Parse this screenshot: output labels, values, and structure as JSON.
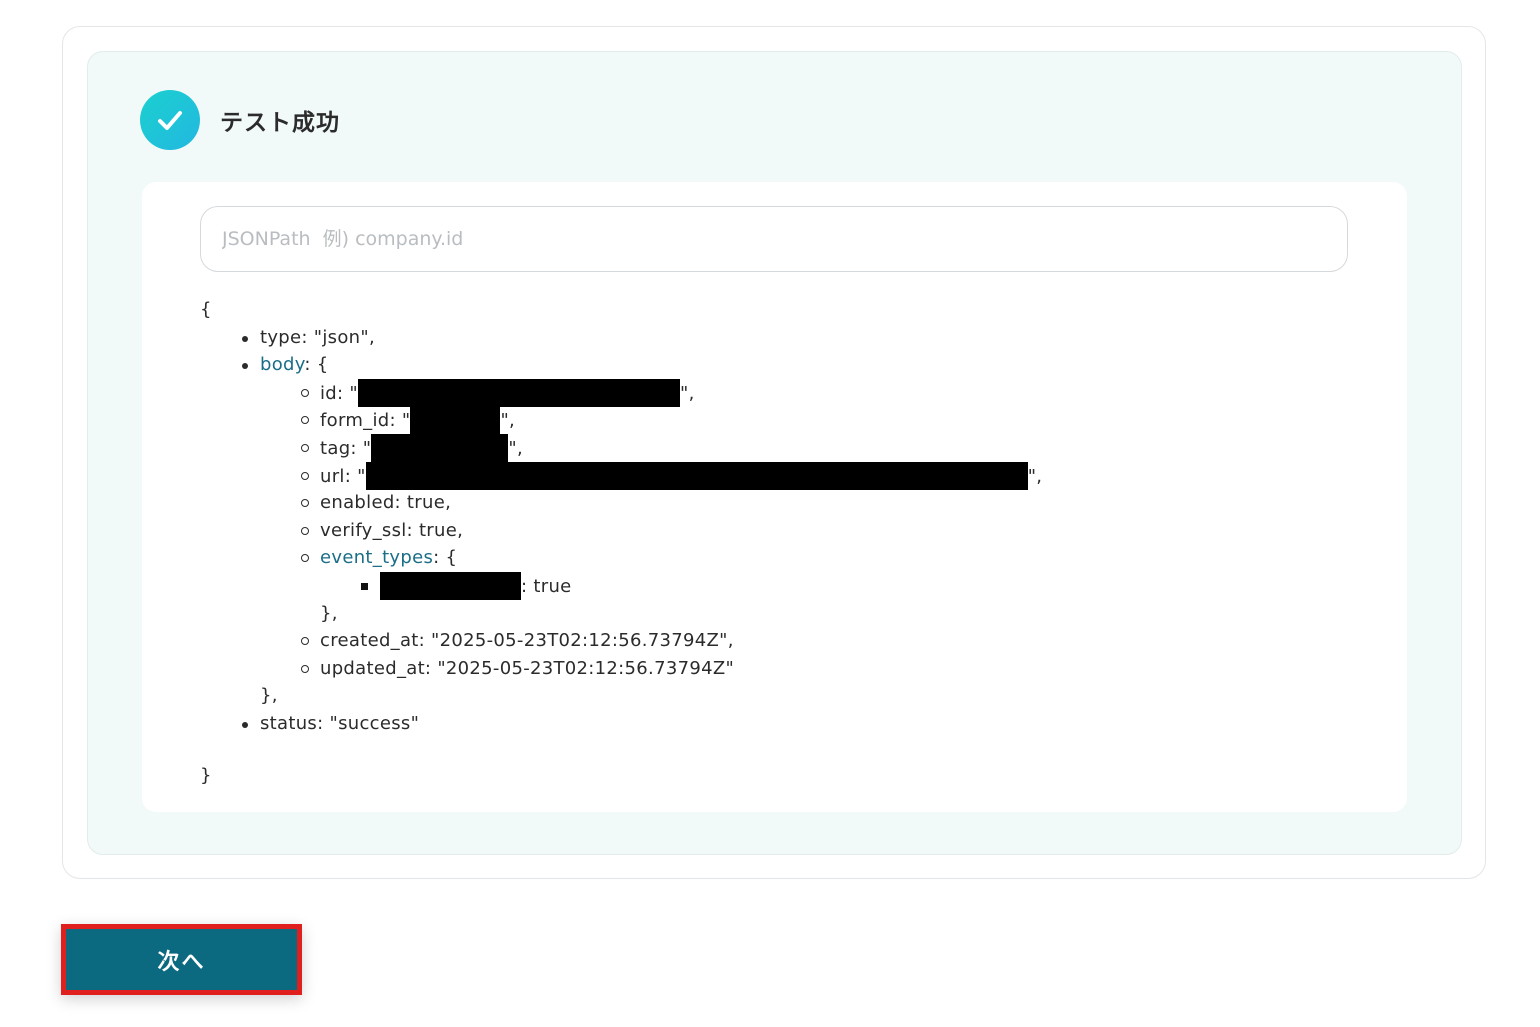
{
  "status": {
    "title": "テスト成功",
    "icon": "check-circle-icon",
    "color": "#1fc4d8"
  },
  "jsonpath_input": {
    "placeholder": "JSONPath  例) company.id",
    "value": ""
  },
  "json_result": {
    "open_brace": "{",
    "type_line": "type: \"json\",",
    "body_key": "body",
    "body_open": ": {",
    "id_prefix": "id: \"",
    "id_suffix": "\",",
    "form_id_prefix": "form_id: \"",
    "form_id_suffix": "\",",
    "tag_prefix": "tag: \"",
    "tag_suffix": "\",",
    "url_prefix": "url: \"",
    "url_suffix": "\",",
    "enabled_line": "enabled: true,",
    "verify_ssl_line": "verify_ssl: true,",
    "event_types_key": "event_types",
    "event_types_open": ": {",
    "event_value": ": true",
    "event_close": "},",
    "created_at_line": "created_at: \"2025-05-23T02:12:56.73794Z\",",
    "updated_at_line": "updated_at: \"2025-05-23T02:12:56.73794Z\"",
    "body_close": "},",
    "status_line": "status: \"success\"",
    "close_brace": "}"
  },
  "next_button": {
    "label": "次へ",
    "background": "#0b6a80",
    "highlight_border": "#e0201f"
  },
  "colors": {
    "panel_background": "#f1faf9",
    "link_key": "#1a6e87"
  }
}
